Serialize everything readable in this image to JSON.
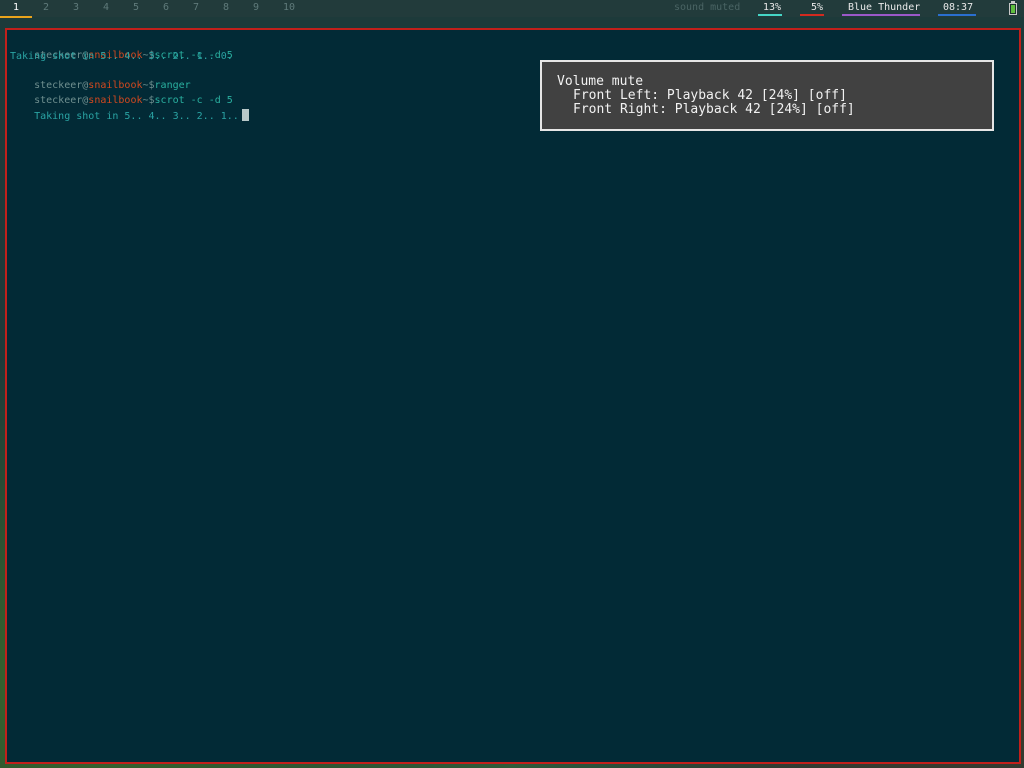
{
  "topbar": {
    "workspaces": [
      "1",
      "2",
      "3",
      "4",
      "5",
      "6",
      "7",
      "8",
      "9",
      "10"
    ],
    "active_workspace": "1",
    "sound_status": "sound muted",
    "stat_a": "13%",
    "stat_b": "5%",
    "network": "Blue Thunder",
    "clock": "08:37",
    "colors": {
      "active_ws": "#e9a31c",
      "stat_a": "#45d6c6",
      "stat_b": "#d32a1f",
      "network": "#9b59c9",
      "clock": "#2a6fd0"
    }
  },
  "terminal": {
    "user": "steckeer",
    "at": "@",
    "host": "snailbook",
    "path_prompt": "~$",
    "lines": [
      {
        "type": "prompt",
        "cmd": "scrot -c -d 5"
      },
      {
        "type": "output",
        "text": "Taking shot in 5.. 4.. 3.. 2.. 1.. 0."
      },
      {
        "type": "prompt",
        "cmd": "ranger"
      },
      {
        "type": "prompt",
        "cmd": "scrot -c -d 5"
      },
      {
        "type": "output",
        "text": "Taking shot in 5.. 4.. 3.. 2.. 1.."
      }
    ],
    "border_color": "#c1201b"
  },
  "notification": {
    "title": "Volume mute",
    "front_left": "Front Left: Playback 42 [24%] [off]",
    "front_right": "Front Right: Playback 42 [24%] [off]"
  }
}
